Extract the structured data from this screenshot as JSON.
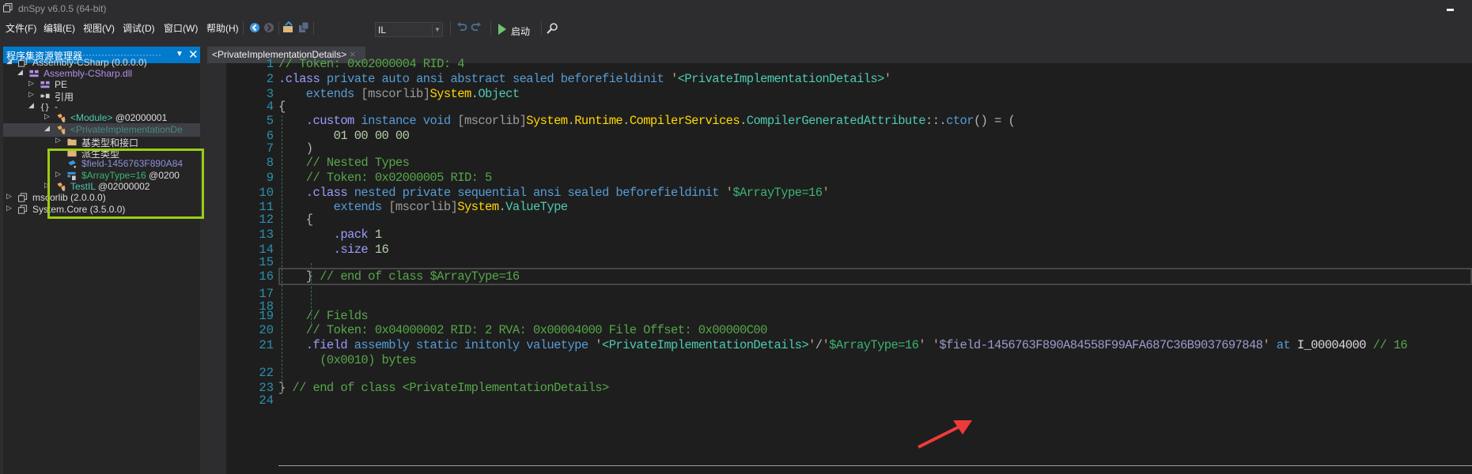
{
  "window": {
    "title": "dnSpy v6.0.5 (64-bit)"
  },
  "menu": [
    {
      "label": "文件(F)"
    },
    {
      "label": "编辑(E)"
    },
    {
      "label": "视图(V)"
    },
    {
      "label": "调试(D)"
    },
    {
      "label": "窗口(W)"
    },
    {
      "label": "帮助(H)"
    }
  ],
  "toolbar": {
    "icons": [
      "navigate-back-icon",
      "navigate-forward-icon",
      "open-file-icon",
      "save-all-icon",
      "undo-icon",
      "redo-icon",
      "start-icon",
      "search-icon"
    ],
    "language_value": "IL",
    "run_label": "启动"
  },
  "assembly_explorer": {
    "title": "程序集资源管理器",
    "items": [
      {
        "label": "Assembly-CSharp (0.0.0.0)",
        "expander": "expanded",
        "icon": "assembly-icon"
      },
      {
        "label": "Assembly-CSharp.dll",
        "expander": "expanded",
        "icon": "module-icon"
      },
      {
        "label": "PE",
        "expander": "collapsed",
        "icon": "pe-icon"
      },
      {
        "label": "引用",
        "expander": "collapsed",
        "icon": "references-icon"
      },
      {
        "label": "-",
        "expander": "expanded",
        "icon": "namespace-icon"
      },
      {
        "label": "<Module>",
        "token": "@02000001",
        "expander": "collapsed",
        "icon": "class-icon"
      },
      {
        "label": "<PrivateImplementationDe",
        "token": "",
        "expander": "expanded",
        "icon": "class-icon",
        "selected": true
      },
      {
        "label": "基类型和接口",
        "expander": "collapsed",
        "icon": "folder-icon"
      },
      {
        "label": "派生类型",
        "expander": "none",
        "icon": "folder-icon"
      },
      {
        "label": "$field-1456763F890A84",
        "expander": "none",
        "icon": "field-icon"
      },
      {
        "label": "$ArrayType=16",
        "token": "@0200",
        "expander": "collapsed",
        "icon": "struct-icon"
      },
      {
        "label": "TestIL",
        "token": "@02000002",
        "expander": "collapsed",
        "icon": "class-icon"
      },
      {
        "label": "mscorlib (2.0.0.0)",
        "expander": "collapsed",
        "icon": "assembly-icon"
      },
      {
        "label": "System.Core (3.5.0.0)",
        "expander": "collapsed",
        "icon": "assembly-icon"
      }
    ]
  },
  "document_tab": {
    "label": "<PrivateImplementationDetails>",
    "close": "×"
  },
  "code": {
    "lines": [
      {
        "n": "1",
        "tokens": [
          [
            "cm",
            "// Token: 0x02000004 RID: 4"
          ]
        ]
      },
      {
        "n": "2",
        "tokens": [
          [
            "dot",
            "."
          ],
          [
            "dir",
            "class"
          ],
          [
            "kw",
            " private auto ansi abstract sealed beforefieldinit "
          ],
          [
            "q",
            "'"
          ],
          [
            "str",
            "<PrivateImplementationDetails>"
          ],
          [
            "q",
            "'"
          ]
        ]
      },
      {
        "n": "3",
        "tokens": [
          [
            "kw",
            "    extends "
          ],
          [
            "asm",
            "[mscorlib]"
          ],
          [
            "ns",
            "System"
          ],
          [
            "pun",
            "."
          ],
          [
            "type",
            "Object"
          ]
        ]
      },
      {
        "n": "4",
        "tokens": [
          [
            "pun",
            "{"
          ]
        ]
      },
      {
        "n": "5",
        "tokens": [
          [
            "dot",
            "    ."
          ],
          [
            "dir",
            "custom"
          ],
          [
            "kw",
            " instance void "
          ],
          [
            "asm",
            "[mscorlib]"
          ],
          [
            "ns",
            "System"
          ],
          [
            "pun",
            "."
          ],
          [
            "ns",
            "Runtime"
          ],
          [
            "pun",
            "."
          ],
          [
            "ns",
            "CompilerServices"
          ],
          [
            "pun",
            "."
          ],
          [
            "type",
            "CompilerGeneratedAttribute"
          ],
          [
            "pun",
            "::"
          ],
          [
            "dot",
            "."
          ],
          [
            "kw",
            "ctor"
          ],
          [
            "pun",
            "() = ("
          ]
        ]
      },
      {
        "n": "6",
        "tokens": [
          [
            "num",
            "        01 00 00 00"
          ]
        ]
      },
      {
        "n": "7",
        "tokens": [
          [
            "pun",
            "    )"
          ]
        ]
      },
      {
        "n": "8",
        "tokens": [
          [
            "cm",
            "    // Nested Types"
          ]
        ]
      },
      {
        "n": "9",
        "tokens": [
          [
            "cm",
            "    // Token: 0x02000005 RID: 5"
          ]
        ]
      },
      {
        "n": "10",
        "tokens": [
          [
            "dot",
            "    ."
          ],
          [
            "dir",
            "class"
          ],
          [
            "kw",
            " nested private sequential ansi sealed beforefieldinit "
          ],
          [
            "q",
            "'"
          ],
          [
            "gr",
            "$ArrayType=16"
          ],
          [
            "q",
            "'"
          ]
        ]
      },
      {
        "n": "11",
        "tokens": [
          [
            "kw",
            "        extends "
          ],
          [
            "asm",
            "[mscorlib]"
          ],
          [
            "ns",
            "System"
          ],
          [
            "pun",
            "."
          ],
          [
            "type",
            "ValueType"
          ]
        ]
      },
      {
        "n": "12",
        "tokens": [
          [
            "pun",
            "    {"
          ]
        ]
      },
      {
        "n": "13",
        "tokens": [
          [
            "dot",
            "        ."
          ],
          [
            "dir",
            "pack"
          ],
          [
            "num",
            " 1"
          ]
        ]
      },
      {
        "n": "14",
        "tokens": [
          [
            "dot",
            "        ."
          ],
          [
            "dir",
            "size"
          ],
          [
            "num",
            " 16"
          ]
        ]
      },
      {
        "n": "15",
        "tokens": []
      },
      {
        "n": "16",
        "tokens": [
          [
            "pun",
            "    }"
          ],
          [
            "cm",
            " // end of class $ArrayType=16"
          ]
        ]
      },
      {
        "n": "17",
        "tokens": []
      },
      {
        "n": "18",
        "tokens": []
      },
      {
        "n": "19",
        "tokens": [
          [
            "cm",
            "    // Fields"
          ]
        ]
      },
      {
        "n": "20",
        "tokens": [
          [
            "cm",
            "    // Token: 0x04000002 RID: 2 RVA: 0x00004000 File Offset: 0x00000C00"
          ]
        ]
      },
      {
        "n": "21",
        "tokens": [
          [
            "dot",
            "    ."
          ],
          [
            "dir",
            "field"
          ],
          [
            "kw",
            " assembly static initonly valuetype "
          ],
          [
            "q",
            "'"
          ],
          [
            "str",
            "<PrivateImplementationDetails>"
          ],
          [
            "q",
            "'"
          ],
          [
            "pun",
            "/"
          ],
          [
            "q",
            "'"
          ],
          [
            "gr",
            "$ArrayType=16"
          ],
          [
            "q",
            "'"
          ],
          [
            "plain",
            " "
          ],
          [
            "q",
            "'"
          ],
          [
            "fld",
            "$field-1456763F890A84558F99AFA687C36B9037697848"
          ],
          [
            "q",
            "'"
          ],
          [
            "kw",
            " at "
          ],
          [
            "plain",
            "I_00004000"
          ],
          [
            "cm",
            " // 16"
          ]
        ]
      },
      {
        "n": "",
        "tokens": [
          [
            "cm",
            "      (0x0010) bytes"
          ]
        ]
      },
      {
        "n": "22",
        "tokens": []
      },
      {
        "n": "23",
        "tokens": [
          [
            "pun",
            "}"
          ],
          [
            "cm",
            " // end of class <PrivateImplementationDetails>"
          ]
        ]
      },
      {
        "n": "24",
        "tokens": []
      }
    ]
  },
  "colors": {
    "accent": "#007acc",
    "highlight_box": "#9acd12",
    "annotation_arrow": "#f03a3a"
  }
}
